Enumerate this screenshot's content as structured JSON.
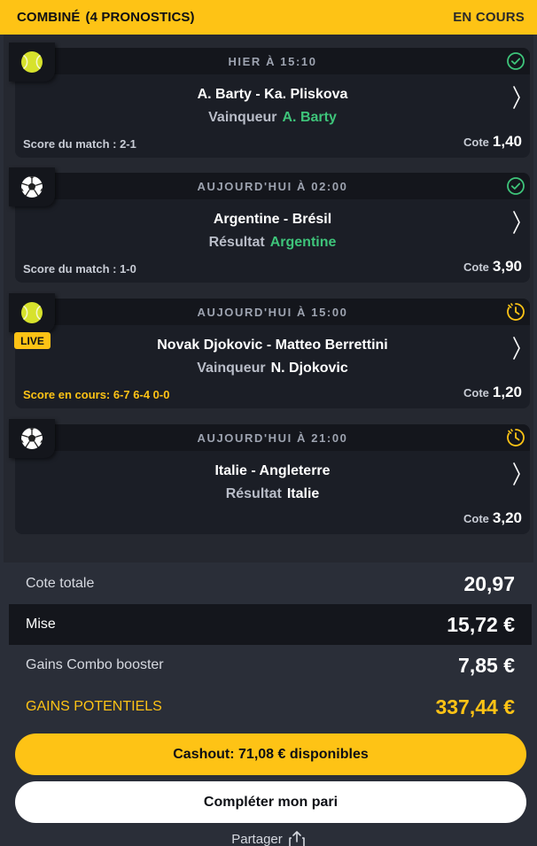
{
  "header": {
    "title": "COMBINÉ",
    "count": "(4 PRONOSTICS)",
    "status": "EN COURS"
  },
  "bets": [
    {
      "sport_icon": "tennis-ball-icon",
      "time": "HIER À 15:10",
      "state_icon": "check-circle-icon",
      "live": "",
      "match": "A. Barty - Ka. Pliskova",
      "market": "Vainqueur",
      "selection": "A. Barty",
      "selection_color": "#3ec47a",
      "score": "Score du match : 2-1",
      "odds_label": "Cote",
      "odds": "1,40"
    },
    {
      "sport_icon": "soccer-ball-icon",
      "time": "AUJOURD'HUI À 02:00",
      "state_icon": "check-circle-icon",
      "live": "",
      "match": "Argentine - Brésil",
      "market": "Résultat",
      "selection": "Argentine",
      "selection_color": "#3ec47a",
      "score": "Score du match : 1-0",
      "odds_label": "Cote",
      "odds": "3,90"
    },
    {
      "sport_icon": "tennis-ball-icon",
      "time": "AUJOURD'HUI À 15:00",
      "state_icon": "clock-pending-icon",
      "live": "LIVE",
      "match": "Novak Djokovic - Matteo Berrettini",
      "market": "Vainqueur",
      "selection": "N. Djokovic",
      "selection_color": "#ffffff",
      "score": "Score en cours: 6-7 6-4 0-0",
      "odds_label": "Cote",
      "odds": "1,20"
    },
    {
      "sport_icon": "soccer-ball-icon",
      "time": "AUJOURD'HUI À 21:00",
      "state_icon": "clock-pending-icon",
      "live": "",
      "match": "Italie - Angleterre",
      "market": "Résultat",
      "selection": "Italie",
      "selection_color": "#ffffff",
      "score": "",
      "odds_label": "Cote",
      "odds": "3,20"
    }
  ],
  "summary": {
    "total_odds_label": "Cote totale",
    "total_odds": "20,97",
    "stake_label": "Mise",
    "stake": "15,72 €",
    "booster_label": "Gains Combo booster",
    "booster": "7,85 €",
    "potential_label": "GAINS POTENTIELS",
    "potential": "337,44 €"
  },
  "actions": {
    "cashout": "Cashout: 71,08 € disponibles",
    "complete": "Compléter mon pari",
    "share": "Partager"
  },
  "colors": {
    "accent": "#fec315",
    "win": "#3ec47a",
    "card_bg": "#1b1e26",
    "page_bg": "#2a2e38"
  }
}
